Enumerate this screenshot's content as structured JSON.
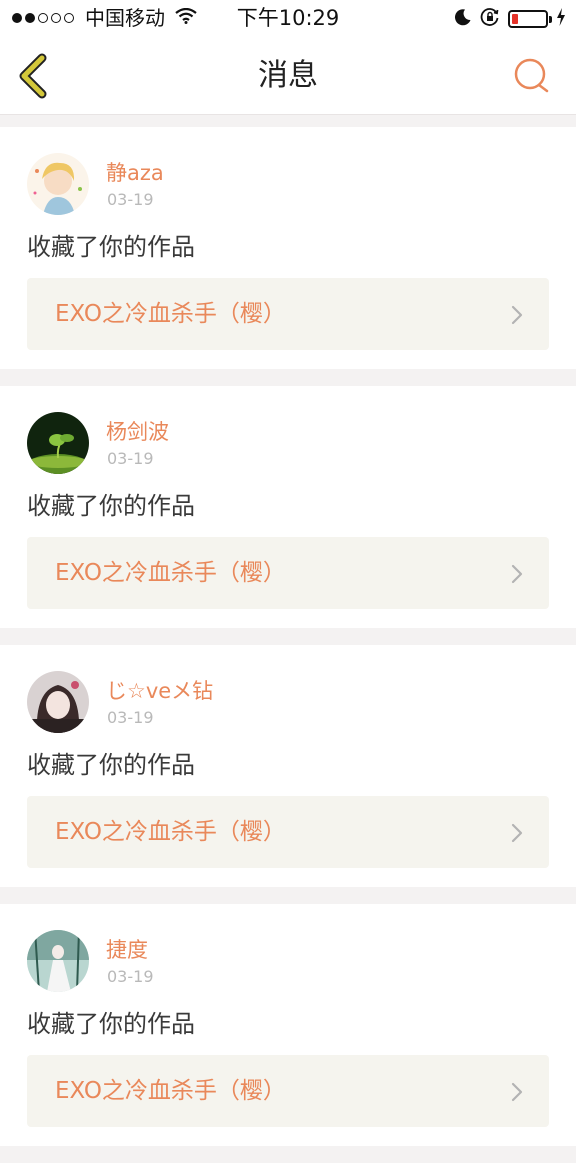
{
  "status_bar": {
    "carrier": "中国移动",
    "time": "下午10:29",
    "signal_filled": 2,
    "signal_total": 5,
    "battery_level": 0.2
  },
  "nav": {
    "title": "消息",
    "back_icon": "chevron-left-icon",
    "search_icon": "search-icon"
  },
  "colors": {
    "accent": "#e9885a",
    "back_icon": "#d4c83a",
    "link_bg": "#f5f4ee",
    "page_bg": "#f4f2f2"
  },
  "messages": [
    {
      "username": "静aza",
      "date": "03-19",
      "action": "收藏了你的作品",
      "work_title": "EXO之冷血杀手（樱）"
    },
    {
      "username": "杨剑波",
      "date": "03-19",
      "action": "收藏了你的作品",
      "work_title": "EXO之冷血杀手（樱）"
    },
    {
      "username": "じ☆veメ钻",
      "date": "03-19",
      "action": "收藏了你的作品",
      "work_title": "EXO之冷血杀手（樱）"
    },
    {
      "username": "捷度",
      "date": "03-19",
      "action": "收藏了你的作品",
      "work_title": "EXO之冷血杀手（樱）"
    }
  ]
}
